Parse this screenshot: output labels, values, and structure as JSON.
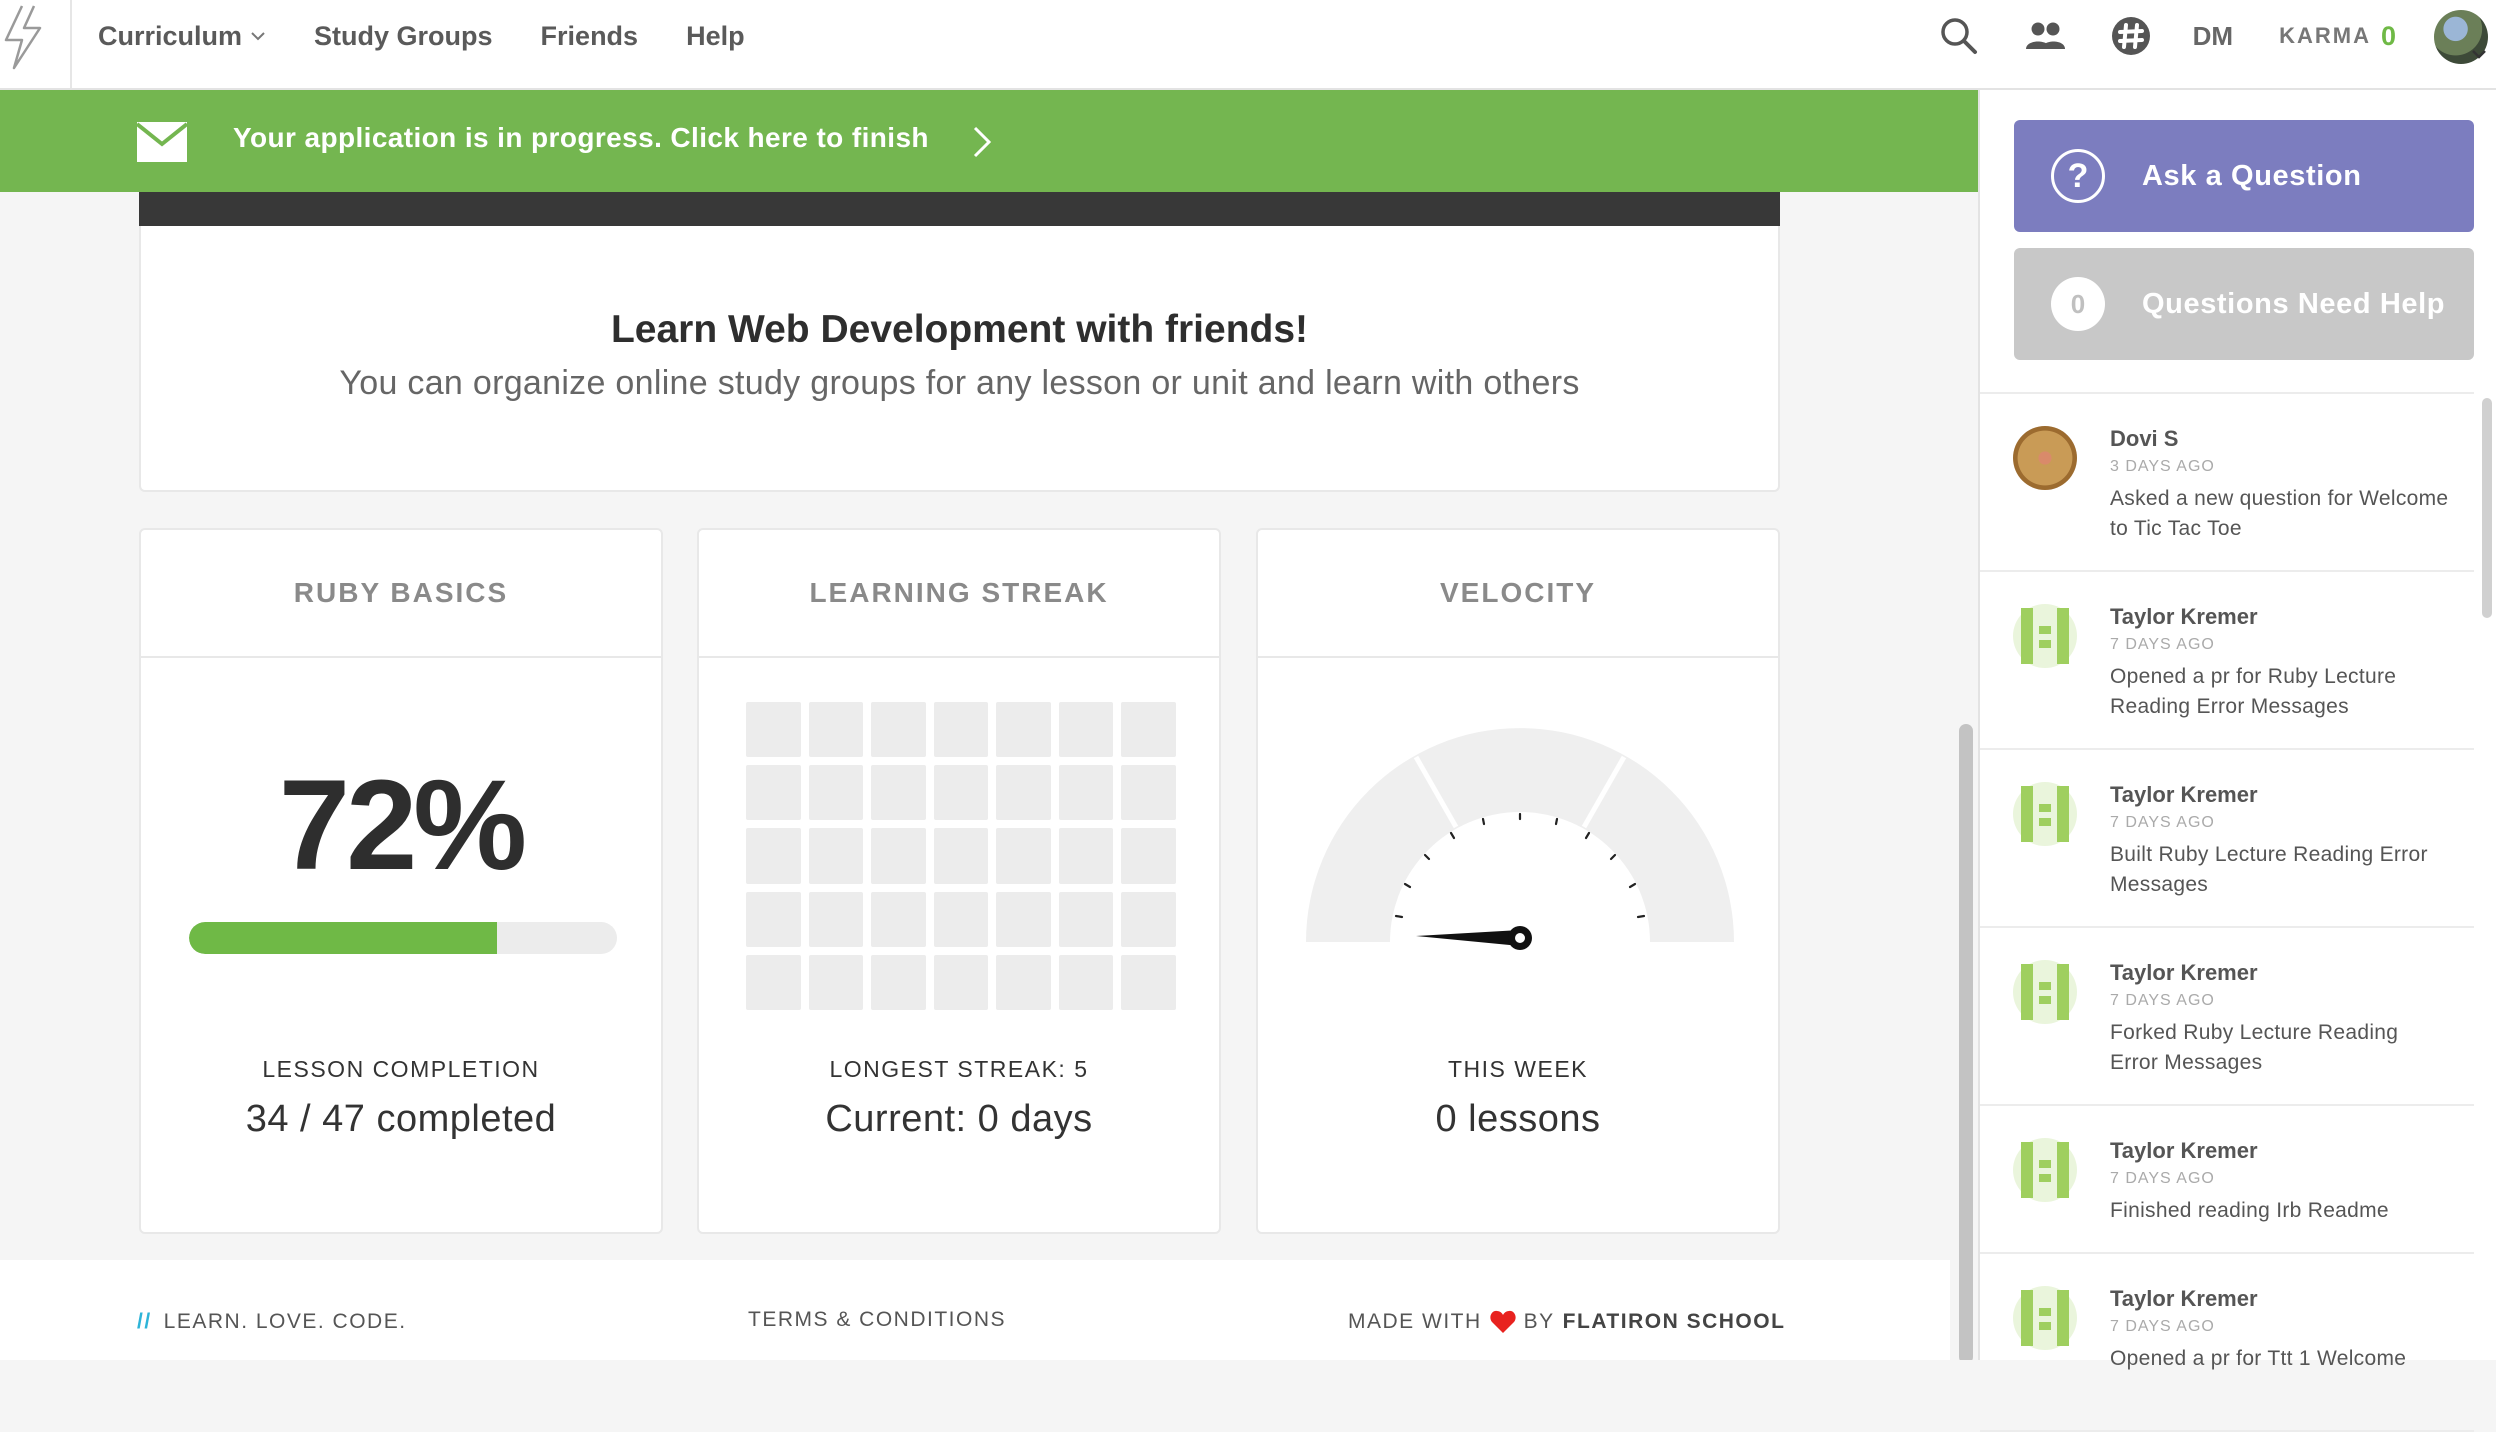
{
  "nav": {
    "links": [
      {
        "label": "Curriculum"
      },
      {
        "label": "Study Groups"
      },
      {
        "label": "Friends"
      },
      {
        "label": "Help"
      }
    ],
    "dm_label": "DM",
    "karma_label": "KARMA",
    "karma_value": "0"
  },
  "banner": {
    "text": "Your application is in progress. Click here to finish"
  },
  "intro": {
    "title": "Learn Web Development with friends!",
    "subtitle": "You can organize online study groups for any lesson or unit and learn with others"
  },
  "cards": {
    "ruby": {
      "title": "RUBY BASICS",
      "percent": "72%",
      "progress": 0.72,
      "label": "LESSON COMPLETION",
      "value": "34 / 47 completed"
    },
    "streak": {
      "title": "LEARNING STREAK",
      "label": "LONGEST STREAK: 5",
      "value": "Current: 0 days"
    },
    "velocity": {
      "title": "VELOCITY",
      "label": "THIS WEEK",
      "value": "0 lessons"
    }
  },
  "footer": {
    "slogan": "LEARN. LOVE. CODE.",
    "terms": "TERMS & CONDITIONS",
    "made_with": "MADE WITH",
    "by": "BY",
    "company": "FLATIRON SCHOOL"
  },
  "sidebar": {
    "ask_label": "Ask a Question",
    "need_help_label": "Questions Need Help",
    "need_help_count": "0",
    "feed": [
      {
        "name": "Dovi S",
        "time": "3 DAYS AGO",
        "text": "Asked a new question for Welcome to Tic Tac Toe"
      },
      {
        "name": "Taylor Kremer",
        "time": "7 DAYS AGO",
        "text": "Opened a pr for Ruby Lecture Reading Error Messages"
      },
      {
        "name": "Taylor Kremer",
        "time": "7 DAYS AGO",
        "text": "Built Ruby Lecture Reading Error Messages"
      },
      {
        "name": "Taylor Kremer",
        "time": "7 DAYS AGO",
        "text": "Forked Ruby Lecture Reading Error Messages"
      },
      {
        "name": "Taylor Kremer",
        "time": "7 DAYS AGO",
        "text": "Finished reading Irb Readme"
      },
      {
        "name": "Taylor Kremer",
        "time": "7 DAYS AGO",
        "text": "Opened a pr for Ttt 1 Welcome"
      }
    ]
  },
  "colors": {
    "green": "#74b650",
    "purple": "#7c7dbf",
    "gray_button": "#c8c8c8",
    "heart": "#e8221f",
    "slashes": "#2eb4d8"
  }
}
